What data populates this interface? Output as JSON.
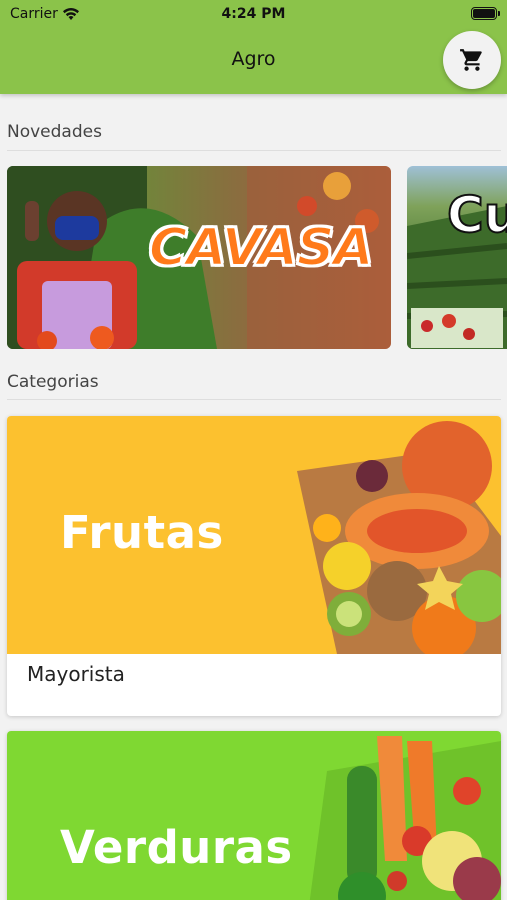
{
  "status_bar": {
    "carrier": "Carrier",
    "time": "4:24 PM"
  },
  "app_bar": {
    "title": "Agro",
    "cart_icon": "shopping-cart-icon"
  },
  "news": {
    "title": "Novedades",
    "banners": [
      {
        "text": "CAVASA"
      },
      {
        "text": "Cu"
      }
    ]
  },
  "categories": {
    "title": "Categorias",
    "items": [
      {
        "image_text": "Frutas",
        "label": "Mayorista",
        "bg_color": "#fcc12f"
      },
      {
        "image_text": "Verduras",
        "label": "",
        "bg_color": "#7fd832"
      }
    ]
  },
  "colors": {
    "app_bar": "#8bc34a",
    "background": "#f2f2f2"
  }
}
